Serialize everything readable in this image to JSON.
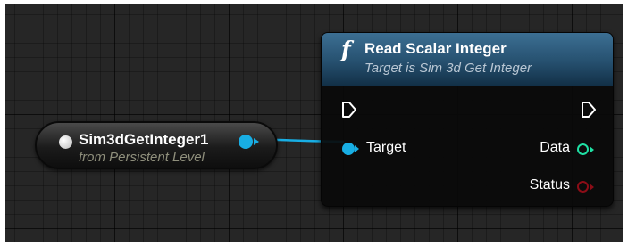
{
  "variable_node": {
    "name": "Sim3dGetInteger1",
    "subtitle": "from Persistent Level"
  },
  "function_node": {
    "icon": "function-f-icon",
    "icon_glyph": "f",
    "title": "Read Scalar Integer",
    "subtitle": "Target is Sim 3d Get Integer",
    "inputs": {
      "target_label": "Target"
    },
    "outputs": {
      "data_label": "Data",
      "status_label": "Status"
    }
  },
  "colors": {
    "object_pin": "#18aee4",
    "integer_pin": "#1fe0a4",
    "status_pin": "#8c0d17",
    "header": "#26506f",
    "grid_background": "#262626"
  }
}
